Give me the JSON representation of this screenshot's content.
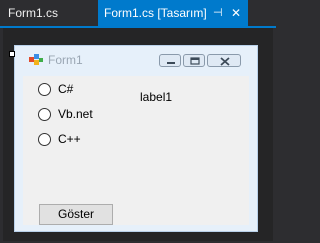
{
  "tabs": {
    "inactive_label": "Form1.cs",
    "active_label": "Form1.cs [Tasarım]",
    "pin_glyph": "⊣",
    "close_glyph": "✕"
  },
  "form": {
    "title": "Form1",
    "radios": [
      {
        "label": "C#"
      },
      {
        "label": "Vb.net"
      },
      {
        "label": "C++"
      }
    ],
    "label1": "label1",
    "button_label": "Göster"
  },
  "colors": {
    "accent": "#007acc",
    "ide_background": "#2d2d30",
    "form_frame": "#e6f0fa",
    "client_background": "#f0f0f0"
  }
}
